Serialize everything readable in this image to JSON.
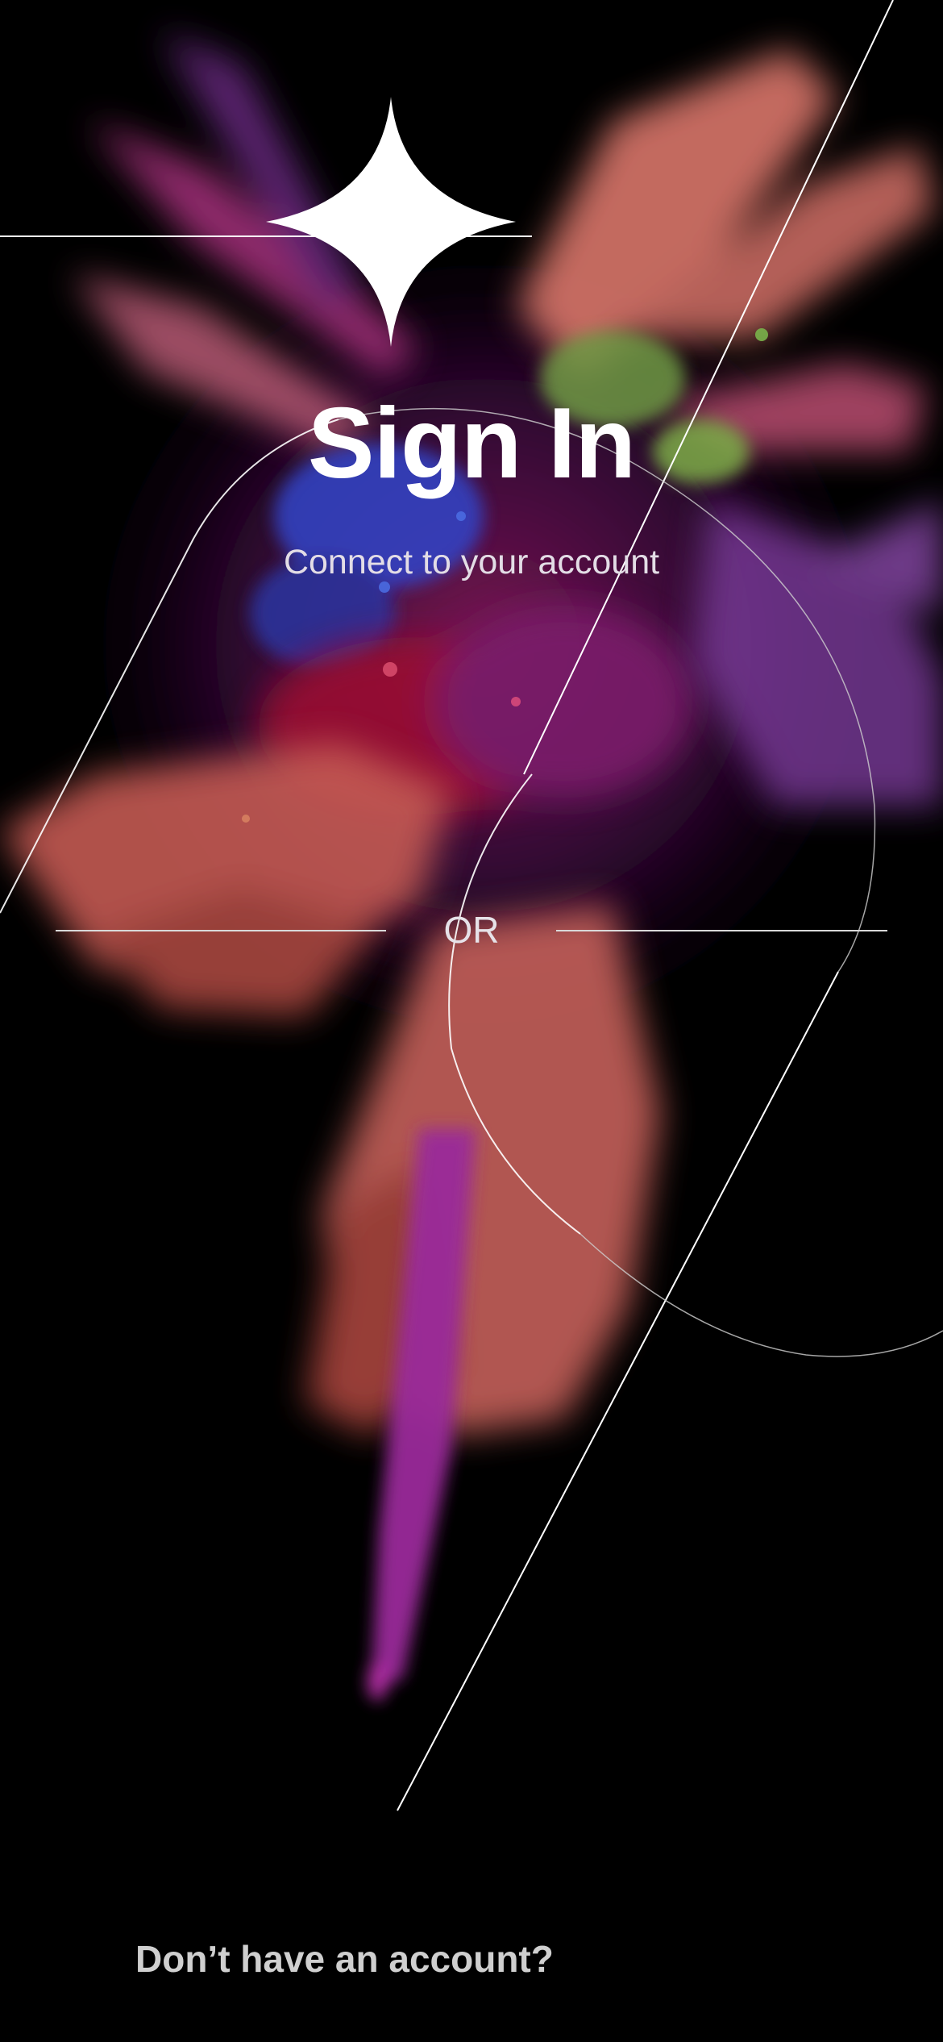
{
  "header": {
    "title": "Sign In",
    "subtitle": "Connect to your account"
  },
  "divider": {
    "label": "OR"
  },
  "footer": {
    "signup_prompt": "Don’t have an account?"
  },
  "icons": {
    "logo": "sparkle-icon"
  },
  "colors": {
    "background": "#000000",
    "text_primary": "#ffffff",
    "text_secondary": "#e3dde6",
    "footer_text": "#cfcfcf",
    "accent_coral": "#e07b6a",
    "accent_purple": "#9b2fa8",
    "accent_blue": "#3b4fd6",
    "accent_green": "#7fae4a"
  }
}
